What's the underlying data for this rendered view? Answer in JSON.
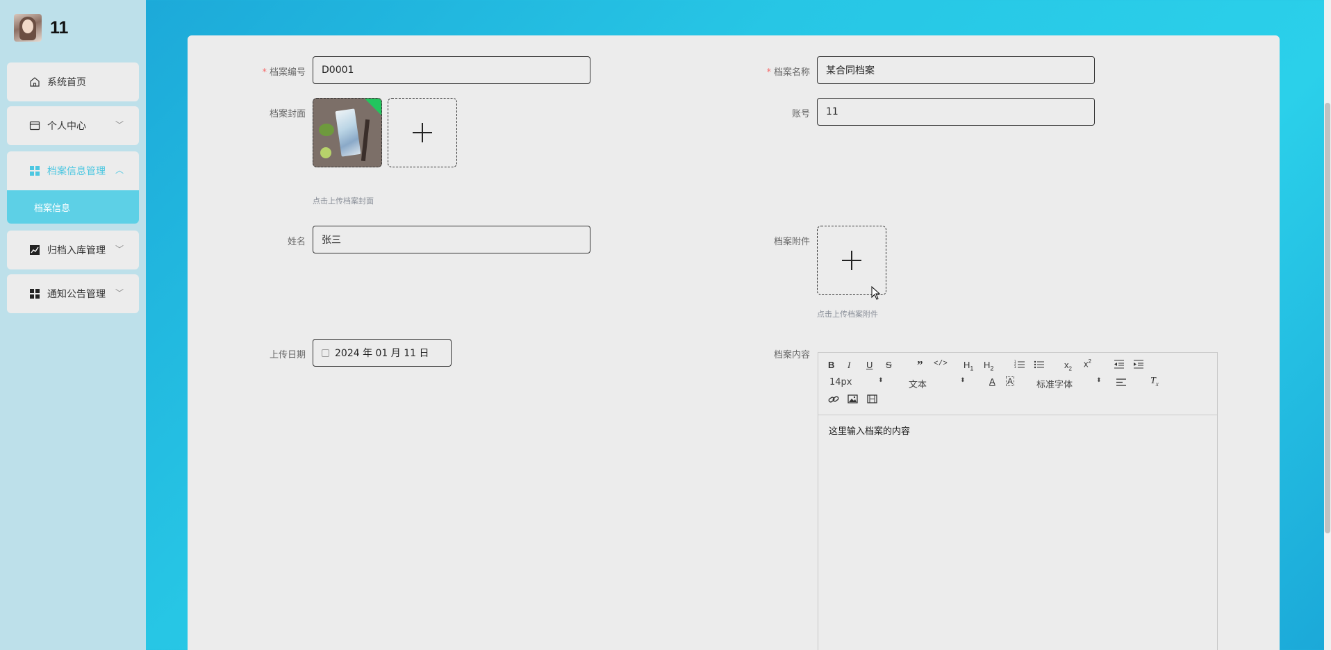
{
  "brand": {
    "username": "11"
  },
  "sidebar": {
    "items": [
      {
        "label": "系统首页"
      },
      {
        "label": "个人中心"
      },
      {
        "label": "档案信息管理"
      },
      {
        "label": "归档入库管理"
      },
      {
        "label": "通知公告管理"
      }
    ],
    "sub_item": {
      "label": "档案信息"
    }
  },
  "form": {
    "archive_no": {
      "label": "档案编号",
      "value": "D0001",
      "required": true
    },
    "archive_name": {
      "label": "档案名称",
      "value": "某合同档案",
      "required": true
    },
    "cover": {
      "label": "档案封面",
      "hint": "点击上传档案封面"
    },
    "account": {
      "label": "账号",
      "value": "11"
    },
    "name": {
      "label": "姓名",
      "value": "张三"
    },
    "attachment": {
      "label": "档案附件",
      "hint": "点击上传档案附件"
    },
    "upload_date": {
      "label": "上传日期",
      "value": "2024 年 01 月 11 日"
    },
    "content": {
      "label": "档案内容",
      "body": "这里输入档案的内容",
      "font_size": "14px",
      "block_type": "文本",
      "font_family": "标准字体"
    }
  },
  "colors": {
    "accent": "#4dc7e1",
    "required": "#f56c6c",
    "active_sub_bg": "#5dd0e6"
  }
}
